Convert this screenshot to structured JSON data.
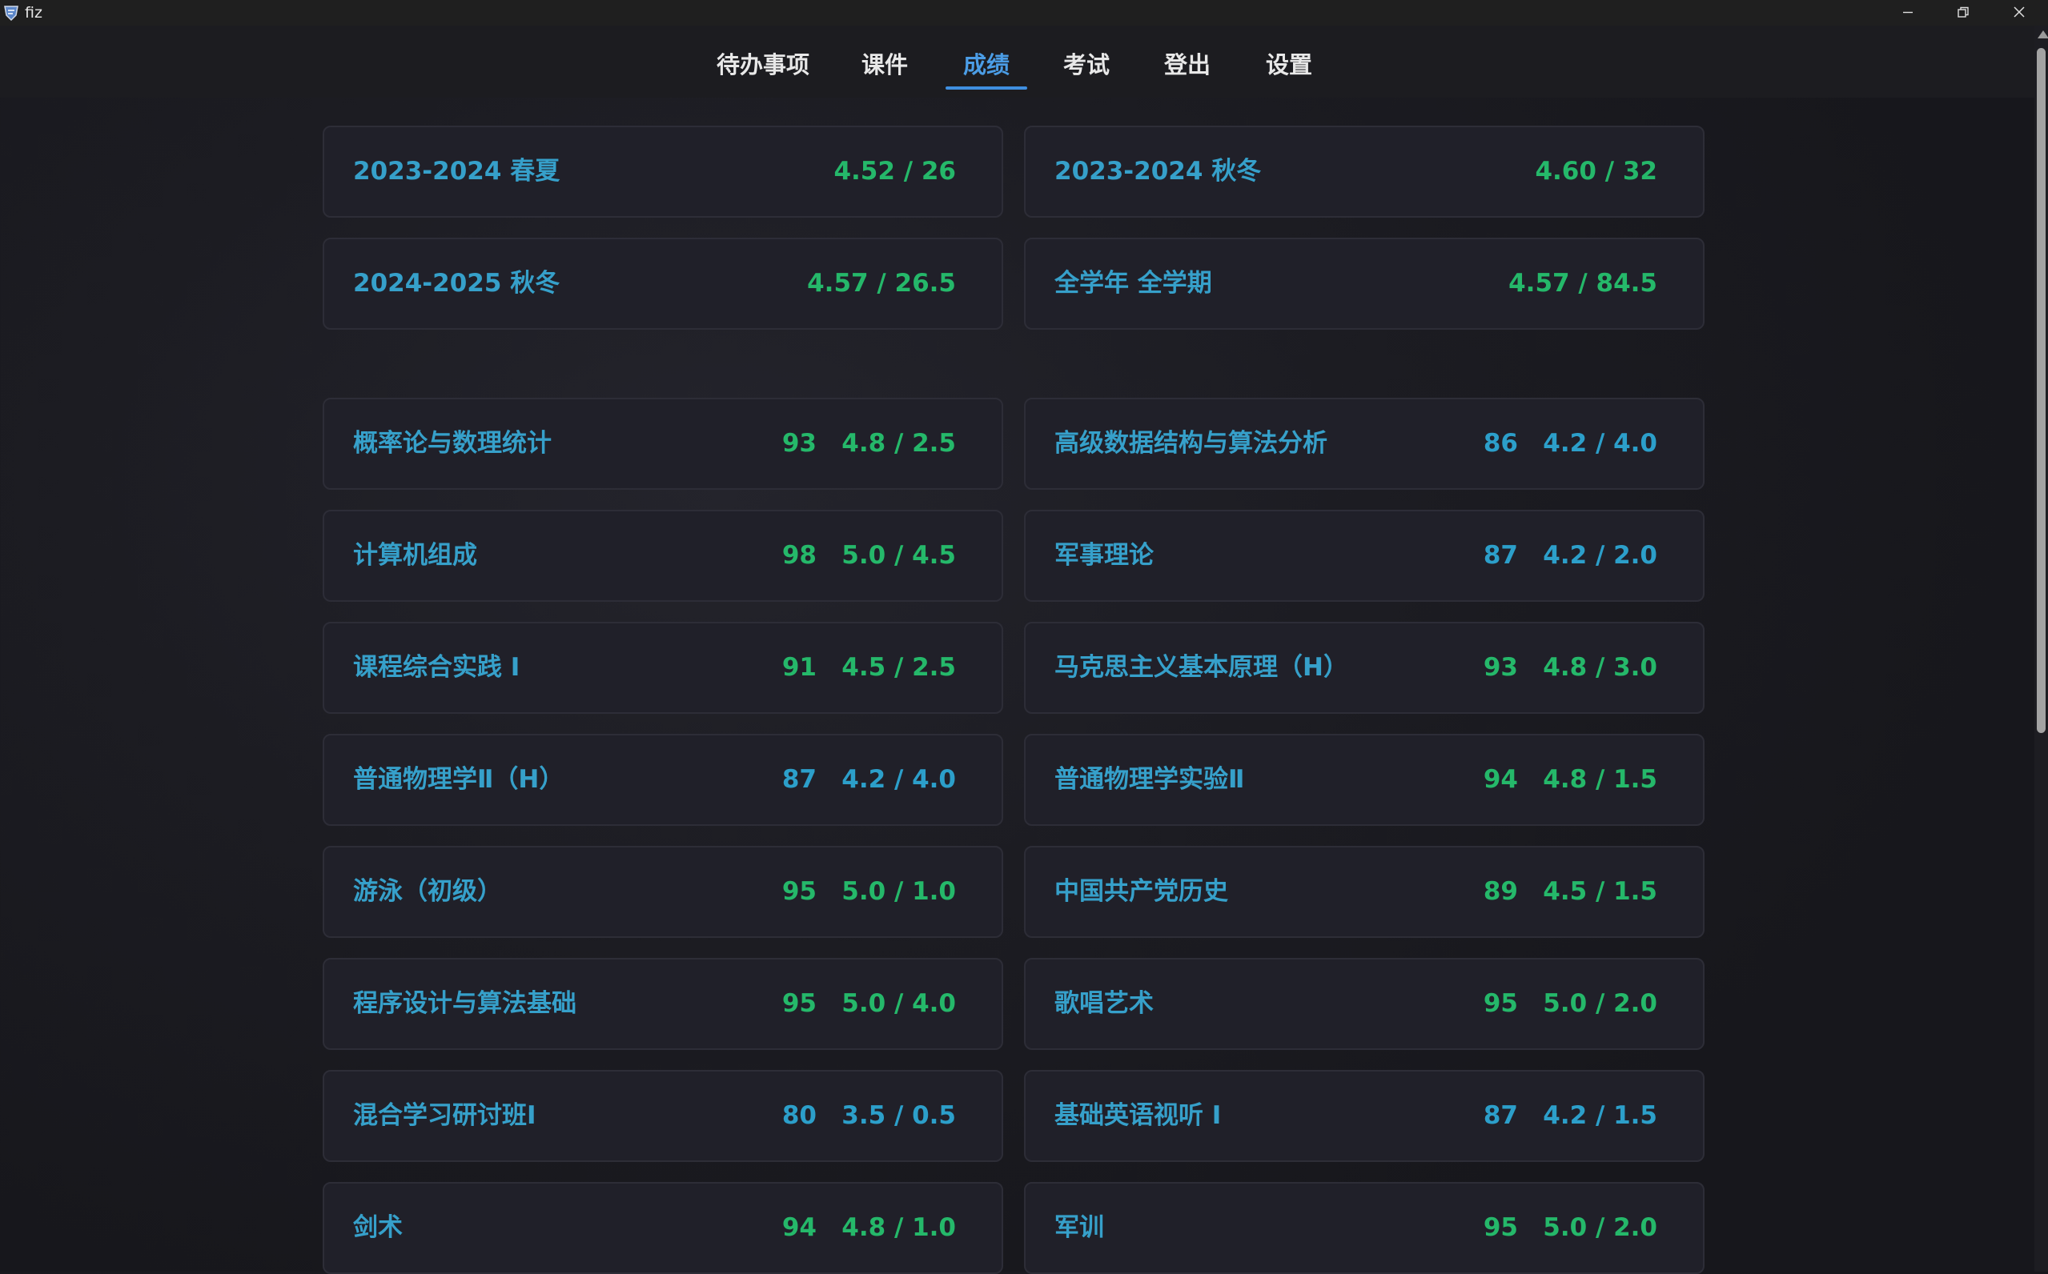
{
  "window": {
    "title": "fiz"
  },
  "nav": {
    "tabs": [
      {
        "label": "待办事项",
        "active": false
      },
      {
        "label": "课件",
        "active": false
      },
      {
        "label": "成绩",
        "active": true
      },
      {
        "label": "考试",
        "active": false
      },
      {
        "label": "登出",
        "active": false
      },
      {
        "label": "设置",
        "active": false
      }
    ]
  },
  "colors": {
    "accent_blue": "#3f8fe0",
    "name_blue": "#36a0ca",
    "grade_green": "#25b86a",
    "grade_teal": "#2c9fca",
    "card_bg": "#202029"
  },
  "summary": [
    {
      "term": "2023-2024 春夏",
      "gpa_credits": "4.52 / 26"
    },
    {
      "term": "2023-2024 秋冬",
      "gpa_credits": "4.60 / 32"
    },
    {
      "term": "2024-2025 秋冬",
      "gpa_credits": "4.57 / 26.5"
    },
    {
      "term": "全学年 全学期",
      "gpa_credits": "4.57 / 84.5"
    }
  ],
  "courses": [
    {
      "name": "概率论与数理统计",
      "score": "93",
      "gpa_credits": "4.8 / 2.5",
      "tone": "green"
    },
    {
      "name": "高级数据结构与算法分析",
      "score": "86",
      "gpa_credits": "4.2 / 4.0",
      "tone": "teal"
    },
    {
      "name": "计算机组成",
      "score": "98",
      "gpa_credits": "5.0 / 4.5",
      "tone": "green"
    },
    {
      "name": "军事理论",
      "score": "87",
      "gpa_credits": "4.2 / 2.0",
      "tone": "teal"
    },
    {
      "name": "课程综合实践 I",
      "score": "91",
      "gpa_credits": "4.5 / 2.5",
      "tone": "green"
    },
    {
      "name": "马克思主义基本原理（H）",
      "score": "93",
      "gpa_credits": "4.8 / 3.0",
      "tone": "green"
    },
    {
      "name": "普通物理学Ⅱ（H）",
      "score": "87",
      "gpa_credits": "4.2 / 4.0",
      "tone": "teal"
    },
    {
      "name": "普通物理学实验Ⅱ",
      "score": "94",
      "gpa_credits": "4.8 / 1.5",
      "tone": "green"
    },
    {
      "name": "游泳（初级）",
      "score": "95",
      "gpa_credits": "5.0 / 1.0",
      "tone": "green"
    },
    {
      "name": "中国共产党历史",
      "score": "89",
      "gpa_credits": "4.5 / 1.5",
      "tone": "green"
    },
    {
      "name": "程序设计与算法基础",
      "score": "95",
      "gpa_credits": "5.0 / 4.0",
      "tone": "green"
    },
    {
      "name": "歌唱艺术",
      "score": "95",
      "gpa_credits": "5.0 / 2.0",
      "tone": "green"
    },
    {
      "name": "混合学习研讨班I",
      "score": "80",
      "gpa_credits": "3.5 / 0.5",
      "tone": "teal"
    },
    {
      "name": "基础英语视听 I",
      "score": "87",
      "gpa_credits": "4.2 / 1.5",
      "tone": "teal"
    },
    {
      "name": "剑术",
      "score": "94",
      "gpa_credits": "4.8 / 1.0",
      "tone": "green"
    },
    {
      "name": "军训",
      "score": "95",
      "gpa_credits": "5.0 / 2.0",
      "tone": "green"
    }
  ]
}
